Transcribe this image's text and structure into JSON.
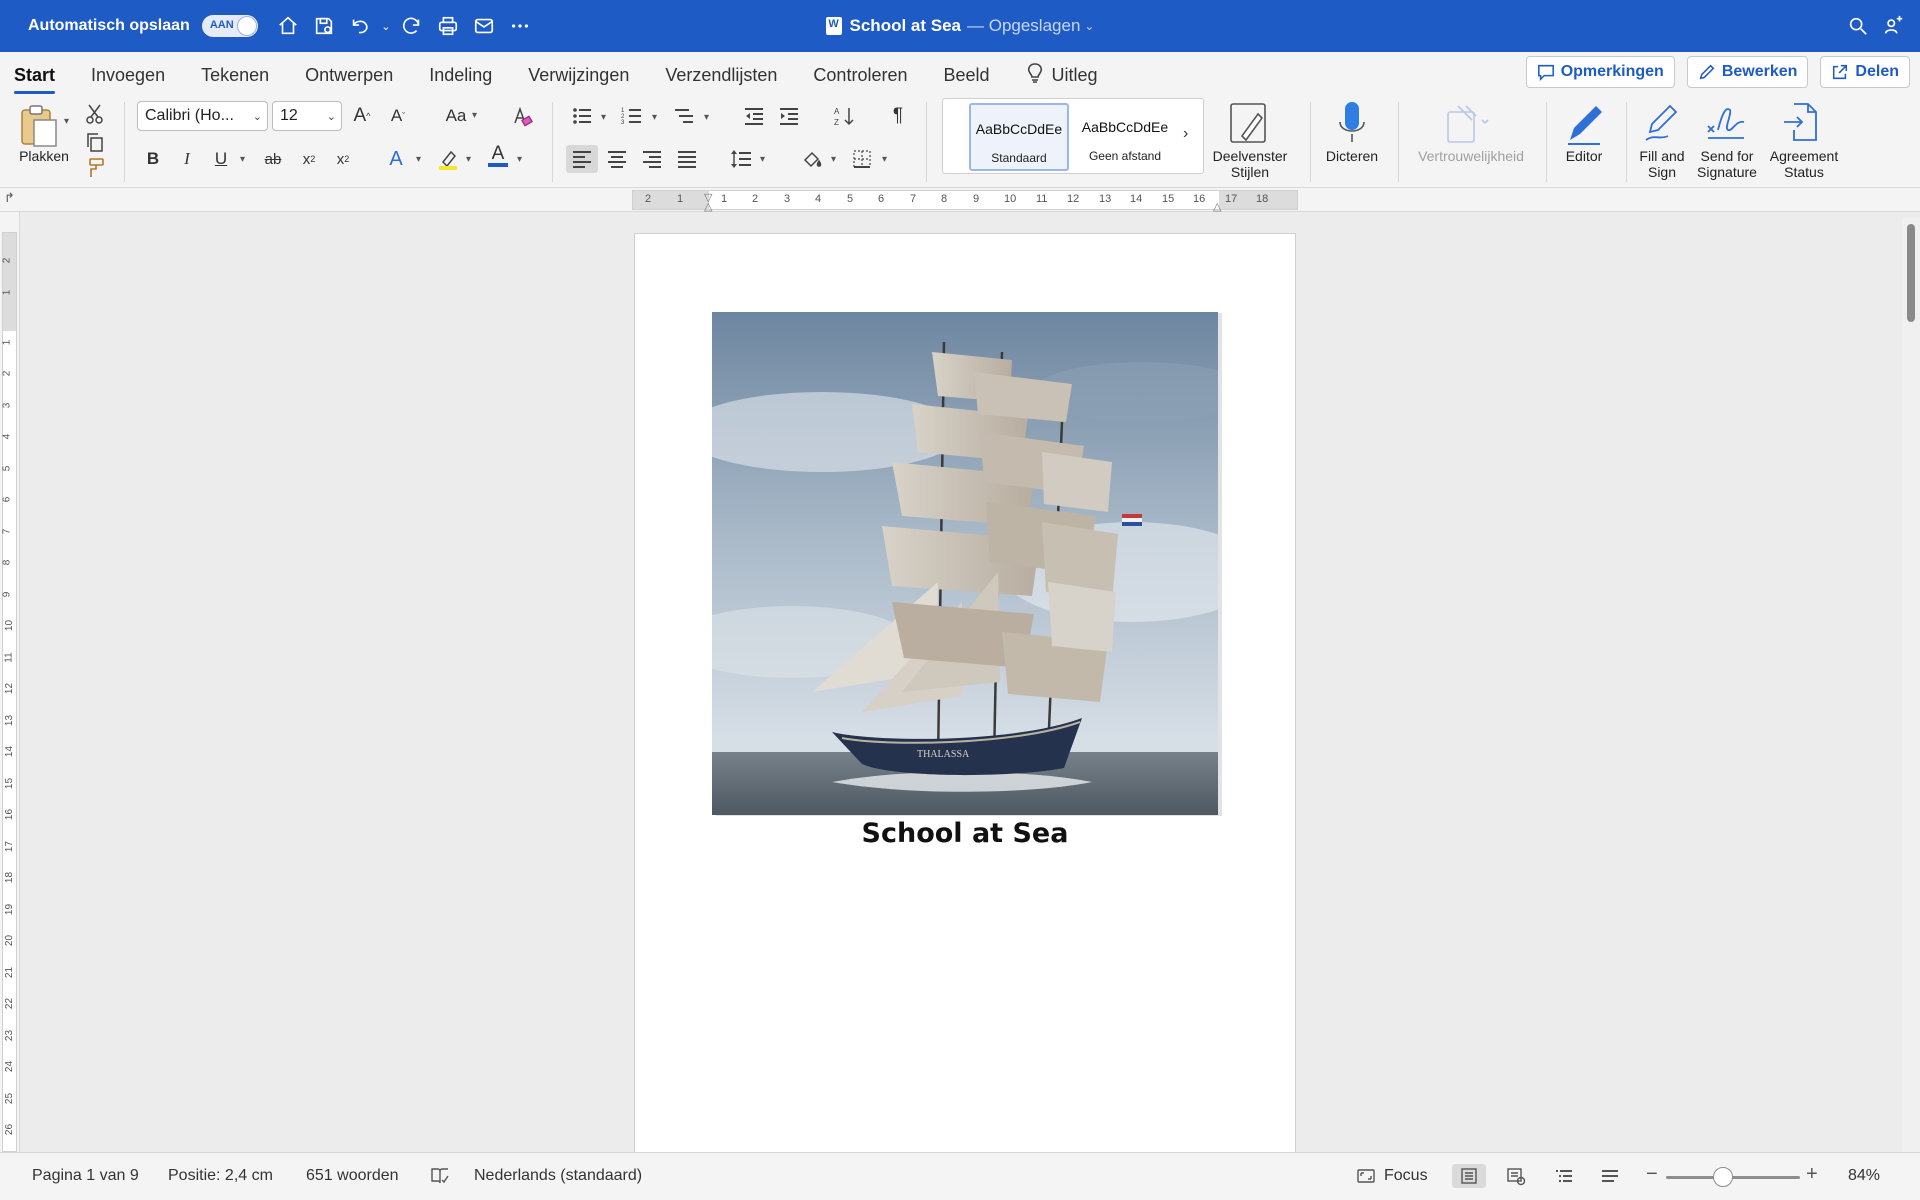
{
  "titlebar": {
    "autosave_label": "Automatisch opslaan",
    "autosave_state": "AAN",
    "doc_title": "School at Sea",
    "saved_status": "— Opgeslagen"
  },
  "tabs": [
    {
      "label": "Start",
      "active": true
    },
    {
      "label": "Invoegen"
    },
    {
      "label": "Tekenen"
    },
    {
      "label": "Ontwerpen"
    },
    {
      "label": "Indeling"
    },
    {
      "label": "Verwijzingen"
    },
    {
      "label": "Verzendlijsten"
    },
    {
      "label": "Controleren"
    },
    {
      "label": "Beeld"
    },
    {
      "label": "Uitleg"
    }
  ],
  "tab_actions": {
    "comments": "Opmerkingen",
    "edit": "Bewerken",
    "share": "Delen"
  },
  "ribbon": {
    "paste_label": "Plakken",
    "font_name": "Calibri (Ho...",
    "font_size": "12",
    "styles": [
      {
        "sample": "AaBbCcDdEe",
        "name": "Standaard",
        "selected": true
      },
      {
        "sample": "AaBbCcDdEe",
        "name": "Geen afstand"
      }
    ],
    "styles_pane_label": "Deelvenster Stijlen",
    "dictate_label": "Dicteren",
    "sensitivity_label": "Vertrouwelijkheid",
    "editor_label": "Editor",
    "fill_sign_label": "Fill and Sign",
    "send_signature_label": "Send for Signature",
    "agreement_status_label": "Agreement Status"
  },
  "ruler": {
    "h_numbers": [
      "2",
      "1",
      "1",
      "2",
      "3",
      "4",
      "5",
      "6",
      "7",
      "8",
      "9",
      "10",
      "11",
      "12",
      "13",
      "14",
      "15",
      "16",
      "17",
      "18"
    ],
    "v_numbers": [
      "2",
      "1",
      "1",
      "2",
      "3",
      "4",
      "5",
      "6",
      "7",
      "8",
      "9",
      "10",
      "11",
      "12",
      "13",
      "14",
      "15",
      "16",
      "17",
      "18",
      "19",
      "20",
      "21",
      "22",
      "23",
      "24",
      "25",
      "26"
    ]
  },
  "document": {
    "heading": "School at Sea",
    "image_ship_name": "THALASSA"
  },
  "statusbar": {
    "page": "Pagina 1 van 9",
    "position": "Positie: 2,4 cm",
    "words": "651 woorden",
    "language": "Nederlands (standaard)",
    "focus": "Focus",
    "zoom": "84%"
  },
  "colors": {
    "titlebar": "#1f5bc4",
    "accent": "#1f5bc4",
    "ribbon_bg": "#f4f4f4",
    "canvas_bg": "#ececec"
  }
}
